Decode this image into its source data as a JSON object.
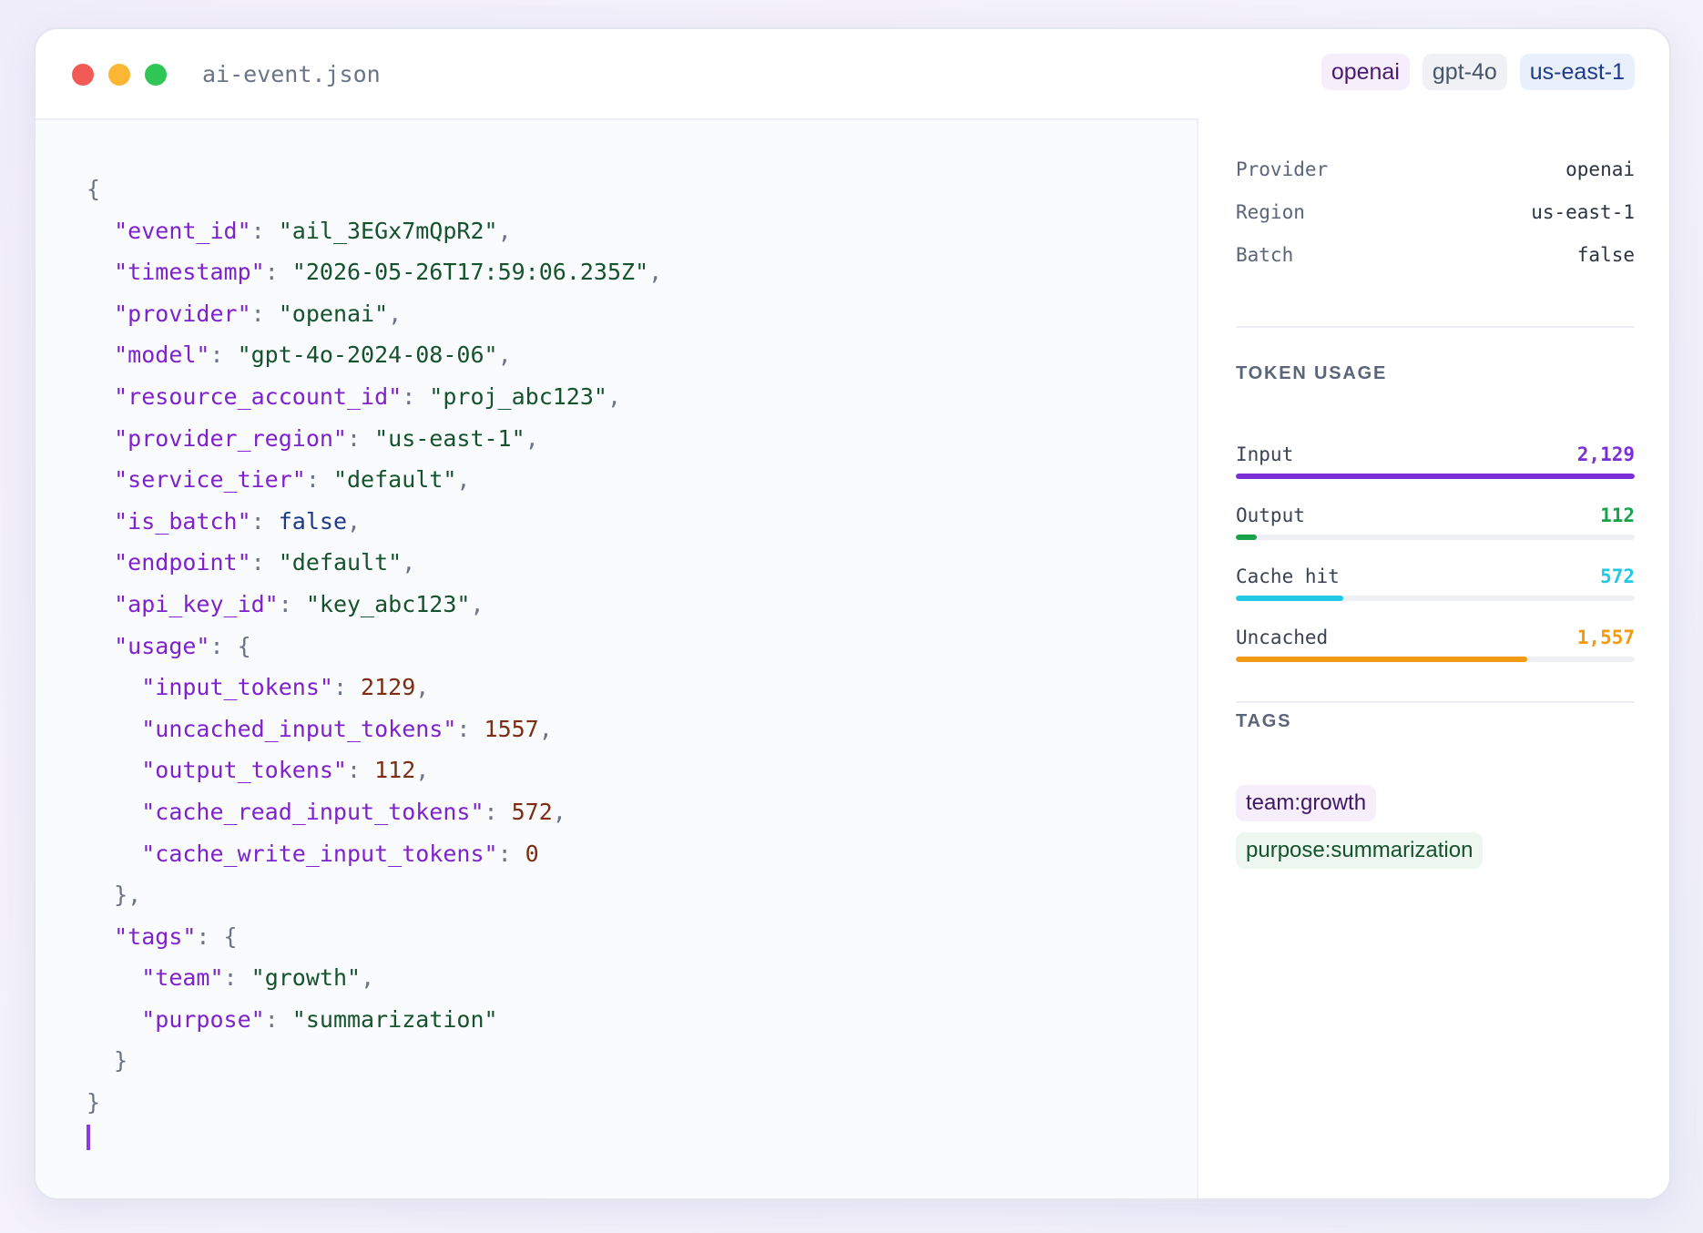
{
  "window": {
    "filename": "ai-event.json",
    "badges": [
      "openai",
      "gpt-4o",
      "us-east-1"
    ]
  },
  "code": {
    "open_brace": "{",
    "close_brace": "}",
    "event_id_key": "\"event_id\"",
    "event_id_val": "\"ail_3EGx7mQpR2\"",
    "timestamp_key": "\"timestamp\"",
    "timestamp_val": "\"2026-05-26T17:59:06.235Z\"",
    "provider_key": "\"provider\"",
    "provider_val": "\"openai\"",
    "model_key": "\"model\"",
    "model_val": "\"gpt-4o-2024-08-06\"",
    "resource_account_id_key": "\"resource_account_id\"",
    "resource_account_id_val": "\"proj_abc123\"",
    "provider_region_key": "\"provider_region\"",
    "provider_region_val": "\"us-east-1\"",
    "service_tier_key": "\"service_tier\"",
    "service_tier_val": "\"default\"",
    "is_batch_key": "\"is_batch\"",
    "is_batch_val": "false",
    "endpoint_key": "\"endpoint\"",
    "endpoint_val": "\"default\"",
    "api_key_id_key": "\"api_key_id\"",
    "api_key_id_val": "\"key_abc123\"",
    "usage_key": "\"usage\"",
    "input_tokens_key": "\"input_tokens\"",
    "input_tokens_val": "2129",
    "uncached_input_tokens_key": "\"uncached_input_tokens\"",
    "uncached_input_tokens_val": "1557",
    "output_tokens_key": "\"output_tokens\"",
    "output_tokens_val": "112",
    "cache_read_input_tokens_key": "\"cache_read_input_tokens\"",
    "cache_read_input_tokens_val": "572",
    "cache_write_input_tokens_key": "\"cache_write_input_tokens\"",
    "cache_write_input_tokens_val": "0",
    "usage_close": "},",
    "tags_key": "\"tags\"",
    "team_key": "\"team\"",
    "team_val": "\"growth\"",
    "purpose_key": "\"purpose\"",
    "purpose_val": "\"summarization\"",
    "tags_close": "}"
  },
  "details": {
    "provider_label": "Provider",
    "provider_value": "openai",
    "region_label": "Region",
    "region_value": "us-east-1",
    "batch_label": "Batch",
    "batch_value": "false"
  },
  "token_usage": {
    "title": "TOKEN USAGE",
    "items": [
      {
        "label": "Input",
        "value": "2,129",
        "fraction": 1.0,
        "color": "#7c2ed6"
      },
      {
        "label": "Output",
        "value": "112",
        "fraction": 0.0526,
        "color": "#17a34a"
      },
      {
        "label": "Cache hit",
        "value": "572",
        "fraction": 0.2687,
        "color": "#22c8e5"
      },
      {
        "label": "Uncached",
        "value": "1,557",
        "fraction": 0.7313,
        "color": "#f29a12"
      }
    ]
  },
  "tags_panel": {
    "title": "TAGS",
    "items": [
      "team:growth",
      "purpose:summarization"
    ]
  }
}
